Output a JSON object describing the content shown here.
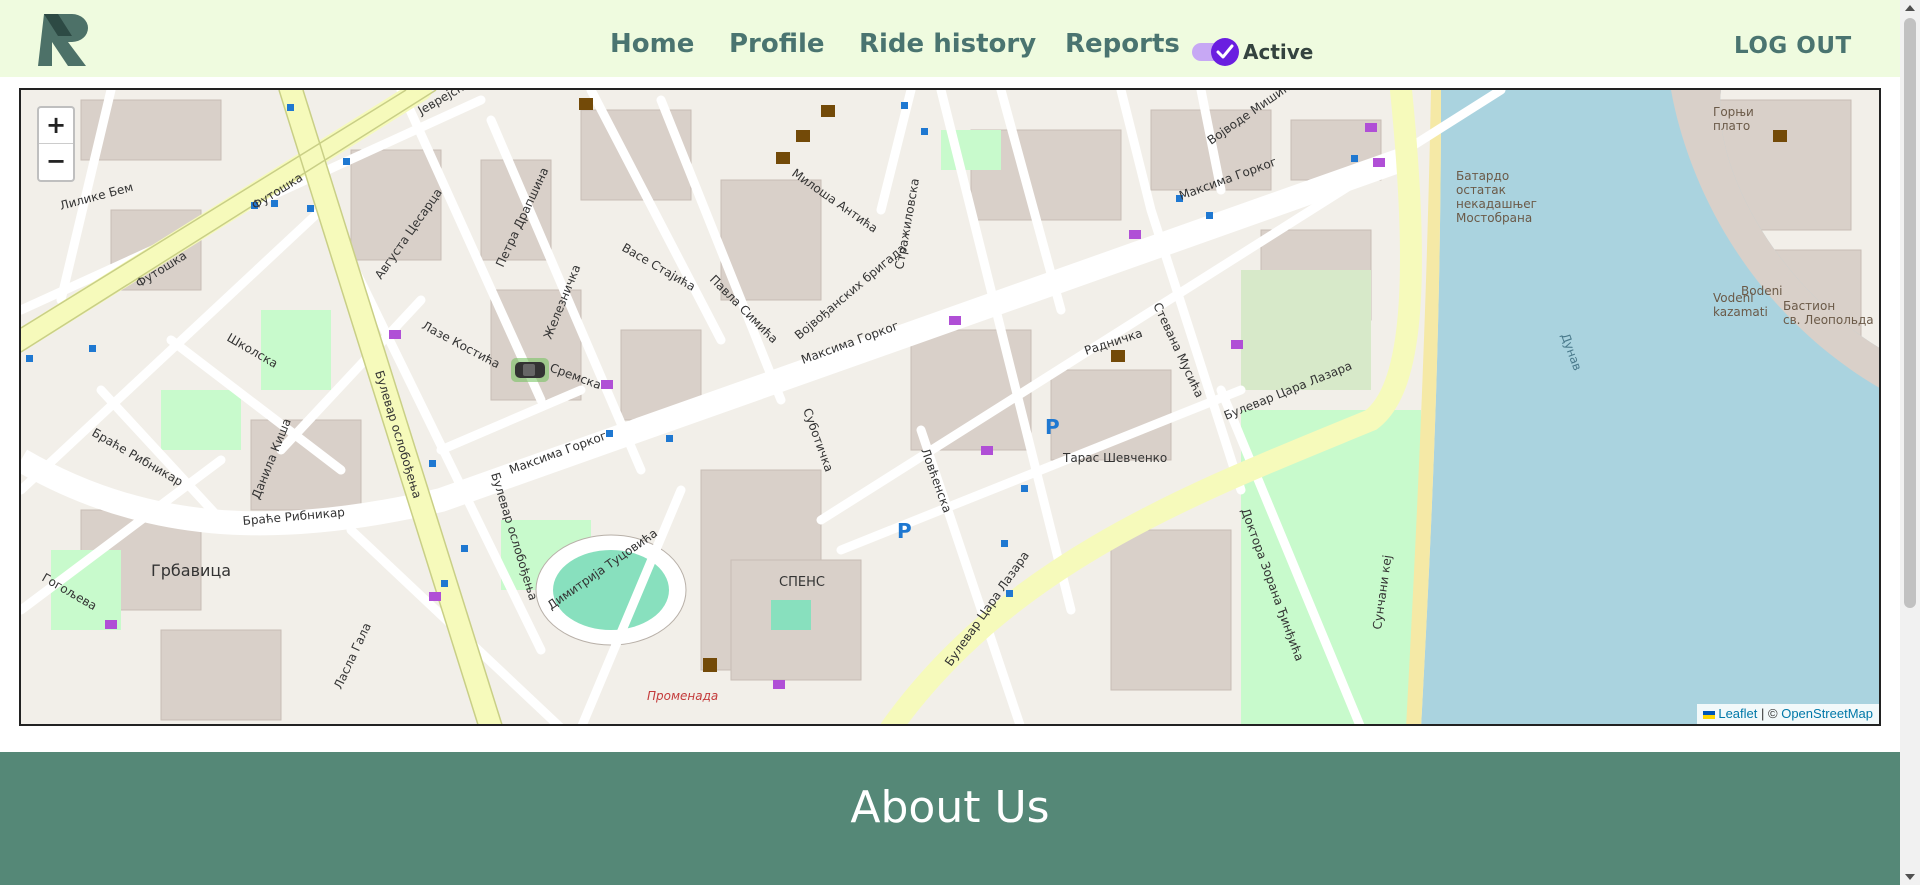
{
  "header": {
    "logo_letter": "R",
    "nav": [
      {
        "label": "Home"
      },
      {
        "label": "Profile"
      },
      {
        "label": "Ride history"
      },
      {
        "label": "Reports"
      }
    ],
    "active_toggle": {
      "label": "Active",
      "checked": true
    },
    "logout_label": "LOG OUT"
  },
  "map": {
    "zoom_in": "+",
    "zoom_out": "−",
    "attribution": {
      "leaflet": "Leaflet",
      "separator": "| ©",
      "osm": "OpenStreetMap"
    },
    "street_labels": [
      "Футошка",
      "Булевар ослобођења",
      "Максима Горког",
      "Браће Рибникар",
      "Сремска",
      "Петра Драпшина",
      "Лазе Костића",
      "Железничка",
      "Васе Стајића",
      "Павла Симића",
      "Војвођанских бригада",
      "Милоша Антића",
      "Стражиловска",
      "Радничка",
      "Стевана Мусића",
      "Булевар Цара Лазара",
      "Доктора Зорана Ђинђића",
      "Тарас Шевченко",
      "Суботичка",
      "Ловћенска",
      "Школска",
      "Данила Киша",
      "Грбавица",
      "Гогољева",
      "Димитрија Туцовића",
      "Сунчани кеј",
      "Дунав",
      "Батардо остатак некадашњег Мостобрана",
      "Горњи плато",
      "Bastion sv. Leopolda",
      "Vodeni kazamati",
      "СПЕНС",
      "Променада",
      "Августа Цесарца",
      "Ласла Гала",
      "Јеврејска",
      "Војводе Мишића",
      "Лилике Бем"
    ],
    "water_color": "#aad3df",
    "major_road_color": "#f6fabb"
  },
  "about": {
    "title": "About Us"
  },
  "colors": {
    "header_bg": "#effbdf",
    "nav_text": "#4a7470",
    "about_bg": "#558877",
    "toggle": "#6a1ee0"
  }
}
